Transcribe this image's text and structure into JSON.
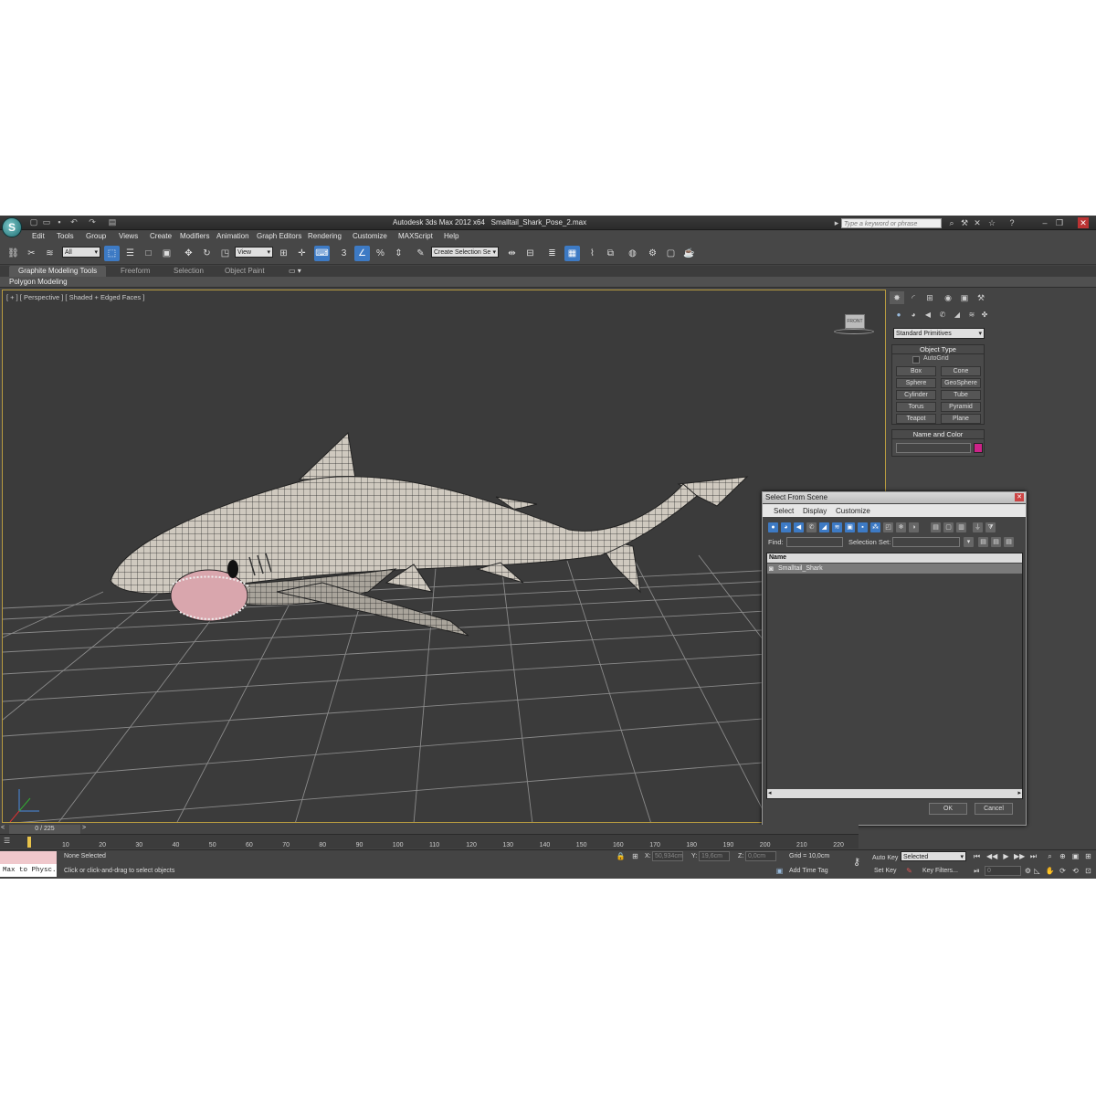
{
  "title_bar": {
    "logo": "S",
    "app_title": "Autodesk 3ds Max  2012 x64",
    "file_name": "Smalltail_Shark_Pose_2.max",
    "search_placeholder": "Type a keyword or phrase"
  },
  "menu": [
    "Edit",
    "Tools",
    "Group",
    "Views",
    "Create",
    "Modifiers",
    "Animation",
    "Graph Editors",
    "Rendering",
    "Customize",
    "MAXScript",
    "Help"
  ],
  "toolbar": {
    "filter_value": "All",
    "ref_coord_value": "View",
    "selection_set_value": "Create Selection Se",
    "snap_3d_label": "3"
  },
  "ribbon": {
    "tabs": [
      "Graphite Modeling Tools",
      "Freeform",
      "Selection",
      "Object Paint"
    ],
    "panel_label": "Polygon Modeling"
  },
  "viewport": {
    "label": "[ + ] [ Perspective ] [ Shaded + Edged Faces ]",
    "viewcube_label": "FRONT",
    "object_name": "Smalltail_Shark"
  },
  "command_panel": {
    "category_value": "Standard Primitives",
    "object_type_title": "Object Type",
    "autogrid_label": "AutoGrid",
    "primitives": [
      "Box",
      "Cone",
      "Sphere",
      "GeoSphere",
      "Cylinder",
      "Tube",
      "Torus",
      "Pyramid",
      "Teapot",
      "Plane"
    ],
    "name_color_title": "Name and Color",
    "object_color": "#cc2288"
  },
  "dialog": {
    "title": "Select From Scene",
    "menu": [
      "Select",
      "Display",
      "Customize"
    ],
    "find_label": "Find:",
    "selection_set_label": "Selection Set:",
    "column_name": "Name",
    "items": [
      "Smalltail_Shark"
    ],
    "ok_label": "OK",
    "cancel_label": "Cancel"
  },
  "timeline": {
    "frame_counter": "0 / 225",
    "ticks": [
      "10",
      "20",
      "30",
      "40",
      "50",
      "60",
      "70",
      "80",
      "90",
      "100",
      "110",
      "120",
      "130",
      "140",
      "150",
      "160",
      "170",
      "180",
      "190",
      "200",
      "210",
      "220"
    ]
  },
  "status": {
    "maxscript_listener": "Max to Physc.",
    "selection_status": "None Selected",
    "prompt": "Click or click-and-drag to select objects",
    "x_label": "X:",
    "x_value": "50,934cm",
    "y_label": "Y:",
    "y_value": "19,6cm",
    "z_label": "Z:",
    "z_value": "0,0cm",
    "grid": "Grid = 10,0cm",
    "add_time_tag": "Add Time Tag",
    "auto_key": "Auto Key",
    "set_key": "Set Key",
    "key_mode_value": "Selected",
    "key_filters": "Key Filters...",
    "current_frame": "0"
  },
  "colors": {
    "accent": "#3d7ac4",
    "viewport_bg": "#3b3b3b",
    "active_viewport_border": "#b89b40"
  }
}
